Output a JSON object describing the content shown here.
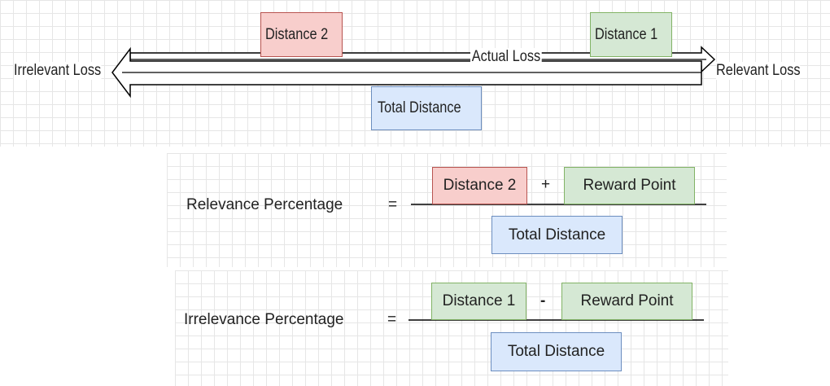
{
  "top_diagram": {
    "distance2": "Distance 2",
    "distance1": "Distance 1",
    "actual_loss": "Actual Loss",
    "irrelevant_loss": "Irrelevant Loss",
    "relevant_loss": "Relevant Loss",
    "total_distance": "Total Distance"
  },
  "relevance_formula": {
    "label": "Relevance Percentage",
    "equals": "=",
    "numerator_left": "Distance 2",
    "operator": "+",
    "numerator_right": "Reward Point",
    "denominator": "Total Distance"
  },
  "irrelevance_formula": {
    "label": "Irrelevance Percentage",
    "equals": "=",
    "numerator_left": "Distance 1",
    "operator": "-",
    "numerator_right": "Reward Point",
    "denominator": "Total Distance"
  },
  "colors": {
    "red_fill": "#f8cecc",
    "green_fill": "#d5e8d4",
    "blue_fill": "#dae8fc"
  }
}
